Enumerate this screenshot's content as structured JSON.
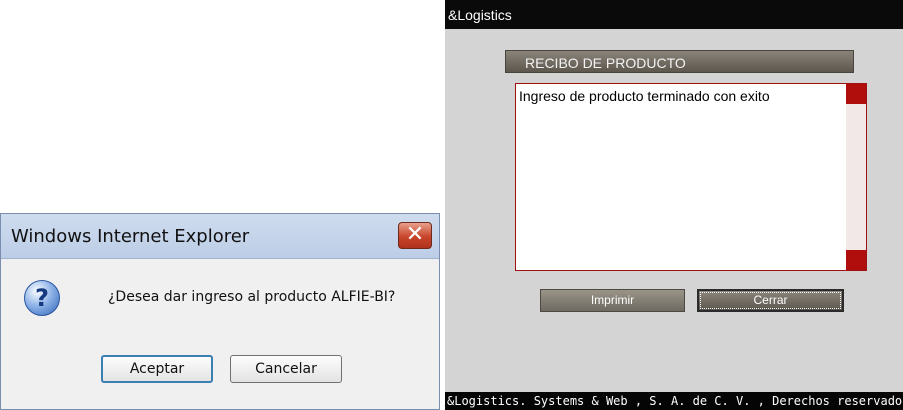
{
  "dialog": {
    "title": "Windows Internet Explorer",
    "close_glyph": "✕",
    "icon": "question-icon",
    "icon_glyph": "?",
    "message": "¿Desea dar ingreso al producto ALFIE-BI?",
    "accept_label": "Aceptar",
    "cancel_label": "Cancelar"
  },
  "app": {
    "header_title": "&Logistics",
    "panel_title": "RECIBO DE PRODUCTO",
    "content_text": "Ingreso de producto terminado con exito",
    "print_label": "Imprimir",
    "close_label": "Cerrar",
    "footer_text": "&Logistics. Systems & Web , S. A. de C. V. , Derechos reservados",
    "colors": {
      "header_bg": "#0a0a0a",
      "panel_bg": "#d4d4d4",
      "accent_red": "#b00d0d",
      "button_bg": "#6f6a61"
    }
  }
}
